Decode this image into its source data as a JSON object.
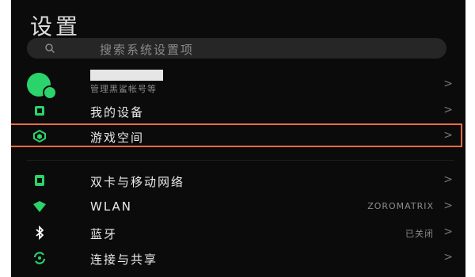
{
  "header": {
    "title": "设置"
  },
  "search": {
    "placeholder": "搜索系统设置项",
    "icon": "search-icon"
  },
  "profile": {
    "subtitle": "管理黑鲨帐号等"
  },
  "settings": {
    "items": [
      {
        "label": "我的设备",
        "icon": "device-icon",
        "value": ""
      },
      {
        "label": "游戏空间",
        "icon": "game-space-icon",
        "value": ""
      },
      {
        "label": "双卡与移动网络",
        "icon": "sim-card-icon",
        "value": ""
      },
      {
        "label": "WLAN",
        "icon": "wifi-icon",
        "value": "ZOROMATRIX"
      },
      {
        "label": "蓝牙",
        "icon": "bluetooth-icon",
        "value": "已关闭"
      },
      {
        "label": "连接与共享",
        "icon": "connection-sharing-icon",
        "value": ""
      }
    ]
  },
  "common": {
    "chevron": ">"
  },
  "colors": {
    "background": "#0b0b0b",
    "accent": "#2bd36b",
    "highlight": "#ef6b45"
  }
}
